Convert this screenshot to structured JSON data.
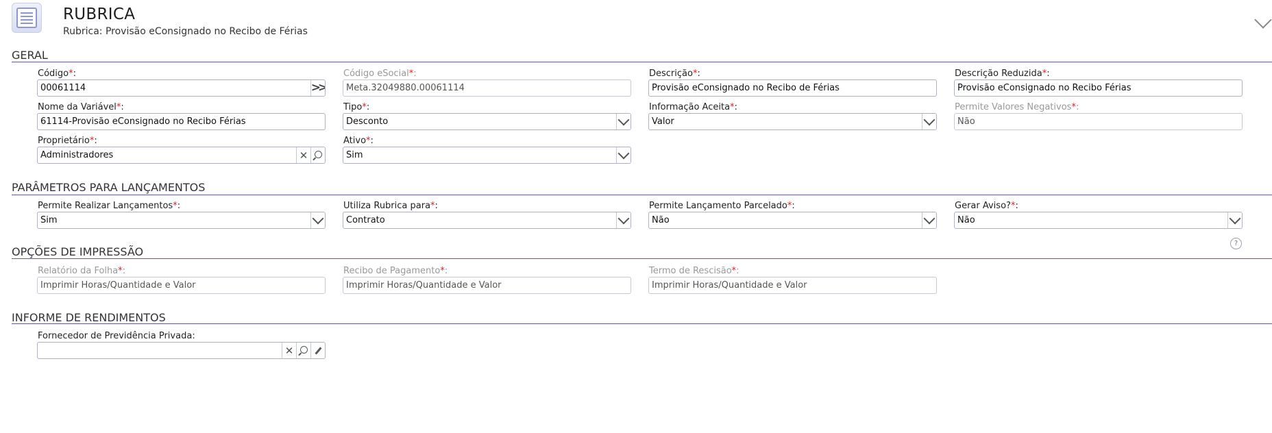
{
  "header": {
    "title": "RUBRICA",
    "subtitle": "Rubrica: Provisão eConsignado no Recibo de Férias"
  },
  "sections": {
    "geral": "GERAL",
    "parametros": "PARÂMETROS PARA LANÇAMENTOS",
    "impressao": "OPÇÕES DE IMPRESSÃO",
    "rendimentos": "INFORME DE RENDIMENTOS"
  },
  "fields": {
    "codigo": {
      "label": "Código",
      "value": "00061114"
    },
    "codigo_esocial": {
      "label": "Código eSocial",
      "value": "Meta.32049880.00061114"
    },
    "descricao": {
      "label": "Descrição",
      "value": "Provisão eConsignado no Recibo de Férias"
    },
    "descricao_reduzida": {
      "label": "Descrição Reduzida",
      "value": "Provisão eConsignado no Recibo Férias"
    },
    "nome_variavel": {
      "label": "Nome da Variável",
      "value": "61114-Provisão eConsignado no Recibo Férias"
    },
    "tipo": {
      "label": "Tipo",
      "value": "Desconto"
    },
    "informacao_aceita": {
      "label": "Informação Aceita",
      "value": "Valor"
    },
    "permite_valores_negativos": {
      "label": "Permite Valores Negativos",
      "value": "Não"
    },
    "proprietario": {
      "label": "Proprietário",
      "value": "Administradores"
    },
    "ativo": {
      "label": "Ativo",
      "value": "Sim"
    },
    "permite_lancamentos": {
      "label": "Permite Realizar Lançamentos",
      "value": "Sim"
    },
    "utiliza_rubrica": {
      "label": "Utiliza Rubrica para",
      "value": "Contrato"
    },
    "lancamento_parcelado": {
      "label": "Permite Lançamento Parcelado",
      "value": "Não"
    },
    "gerar_aviso": {
      "label": "Gerar Aviso?",
      "value": "Não"
    },
    "relatorio_folha": {
      "label": "Relatório da Folha",
      "value": "Imprimir Horas/Quantidade e Valor"
    },
    "recibo_pagamento": {
      "label": "Recibo de Pagamento",
      "value": "Imprimir Horas/Quantidade e Valor"
    },
    "termo_rescisao": {
      "label": "Termo de Rescisão",
      "value": "Imprimir Horas/Quantidade e Valor"
    },
    "fornecedor_previdencia": {
      "label": "Fornecedor de Previdência Privada",
      "value": ""
    }
  },
  "required_mark": "*",
  "colon": ":",
  "icons": {
    "app": "list-document-icon",
    "collapse": "chevron-down-icon",
    "navigate": "double-chevron-right-icon",
    "clear": "clear-x-icon",
    "search": "magnifier-icon",
    "edit": "pencil-icon",
    "help": "help-icon"
  },
  "colors": {
    "section_rule": "#5b5bb0",
    "required": "#e02020",
    "disabled_label": "#999999"
  }
}
